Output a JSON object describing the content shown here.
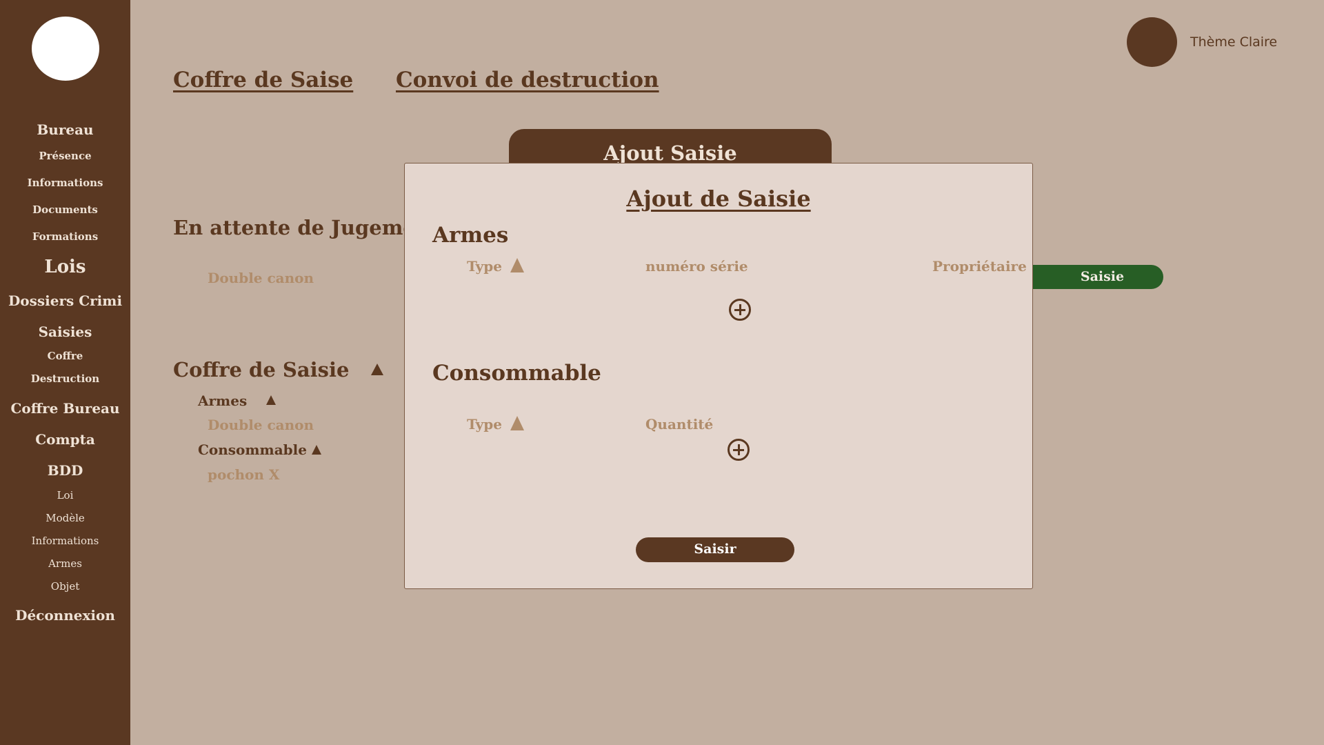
{
  "sidebar": {
    "items": [
      {
        "label": "Bureau"
      },
      {
        "label": "Présence"
      },
      {
        "label": "Informations"
      },
      {
        "label": "Documents"
      },
      {
        "label": "Formations"
      },
      {
        "label": "Lois"
      },
      {
        "label": "Dossiers Crimi"
      },
      {
        "label": "Saisies"
      },
      {
        "label": "Coffre"
      },
      {
        "label": "Destruction"
      },
      {
        "label": "Coffre Bureau"
      },
      {
        "label": "Compta"
      },
      {
        "label": "BDD"
      },
      {
        "label": "Loi"
      },
      {
        "label": "Modèle"
      },
      {
        "label": "Informations"
      },
      {
        "label": "Armes"
      },
      {
        "label": "Objet"
      },
      {
        "label": "Déconnexion"
      }
    ]
  },
  "header": {
    "tabs": [
      {
        "label": "Coffre de Saise"
      },
      {
        "label": "Convoi de destruction"
      }
    ],
    "theme_label": "Thème Claire"
  },
  "main": {
    "pending_title": "En attente de Jugemen",
    "pending_item": "Double canon",
    "saisie_button": "Saisie",
    "ajout_tab": "Ajout Saisie",
    "coffre": {
      "title": "Coffre de Saisie",
      "armes_label": "Armes",
      "armes_item": "Double canon",
      "consommable_label": "Consommable",
      "consommable_item": "pochon X"
    }
  },
  "modal": {
    "title": "Ajout de Saisie",
    "armes": {
      "heading": "Armes",
      "col_type": "Type",
      "col_serial": "numéro série",
      "col_owner": "Propriétaire"
    },
    "consommable": {
      "heading": "Consommable",
      "col_type": "Type",
      "col_qty": "Quantité"
    },
    "submit": "Saisir"
  },
  "colors": {
    "sidebar": "#5a3822",
    "background": "#c2afa0",
    "modal": "#e4d6ce",
    "accent_green": "#275e25",
    "muted_text": "#b08c6a"
  }
}
